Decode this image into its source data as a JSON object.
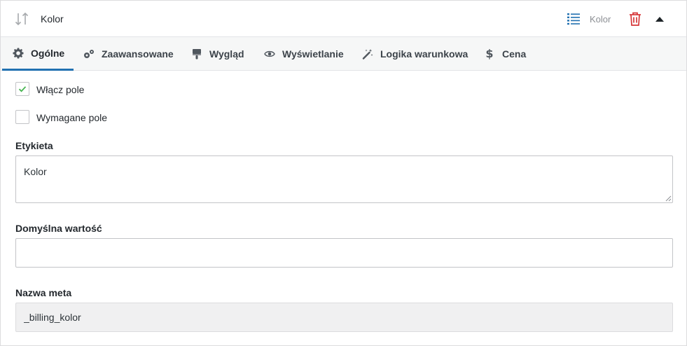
{
  "header": {
    "title": "Kolor",
    "field_type": "Kolor",
    "drag_icon": "sort-arrows-icon",
    "type_icon": "list-icon",
    "delete_icon": "trash-icon",
    "collapse_icon": "caret-up-icon",
    "type_icon_color": "#2271b1",
    "delete_icon_color": "#d63638"
  },
  "tabs": [
    {
      "label": "Ogólne",
      "icon": "gear-icon",
      "active": true
    },
    {
      "label": "Zaawansowane",
      "icon": "gears-icon",
      "active": false
    },
    {
      "label": "Wygląd",
      "icon": "paint-brush-icon",
      "active": false
    },
    {
      "label": "Wyświetlanie",
      "icon": "eye-icon",
      "active": false
    },
    {
      "label": "Logika warunkowa",
      "icon": "magic-wand-icon",
      "active": false
    },
    {
      "label": "Cena",
      "icon": "dollar-icon",
      "active": false
    }
  ],
  "options": {
    "enable_label": "Włącz pole",
    "enable_checked": true,
    "required_label": "Wymagane pole",
    "required_checked": false
  },
  "fields": {
    "label_title": "Etykieta",
    "label_value": "Kolor",
    "default_title": "Domyślna wartość",
    "default_value": "",
    "meta_title": "Nazwa meta",
    "meta_value": "_billing_kolor"
  },
  "colors": {
    "accent": "#2271b1",
    "check": "#46b450"
  }
}
